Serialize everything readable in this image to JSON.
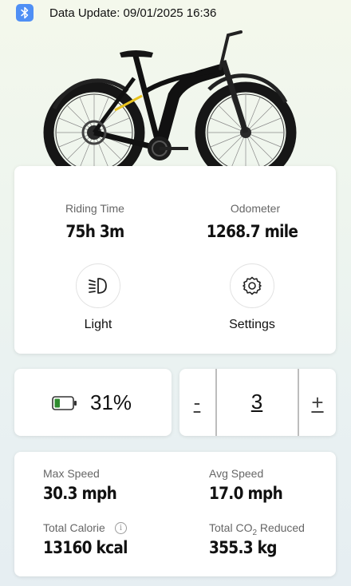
{
  "header": {
    "bluetooth_icon": "bluetooth-icon",
    "update_label": "Data Update: 09/01/2025 16:36"
  },
  "colors": {
    "accent": "#4f8ff5",
    "bike_frame": "#111111",
    "bike_accent": "#e8c21e",
    "battery_fill": "#2e8b2e"
  },
  "ride": {
    "riding_time_label": "Riding Time",
    "riding_time_value": "75h  3m",
    "odometer_label": "Odometer",
    "odometer_value": "1268.7 mile"
  },
  "controls": {
    "light_label": "Light",
    "light_icon": "headlight-icon",
    "settings_label": "Settings",
    "settings_icon": "gear-icon"
  },
  "battery": {
    "icon": "battery-icon",
    "percent_text": "31%",
    "level": 0.31
  },
  "assist": {
    "minus_label": "-",
    "level": "3",
    "plus_label": "+"
  },
  "stats": {
    "max_speed_label": "Max Speed",
    "max_speed_value": "30.3 mph",
    "avg_speed_label": "Avg Speed",
    "avg_speed_value": "17.0 mph",
    "total_calorie_label": "Total Calorie",
    "total_calorie_value": "13160 kcal",
    "co2_label_prefix": "Total CO",
    "co2_label_sub": "2",
    "co2_label_suffix": " Reduced",
    "co2_value": "355.3 kg",
    "info_icon": "info-icon"
  }
}
